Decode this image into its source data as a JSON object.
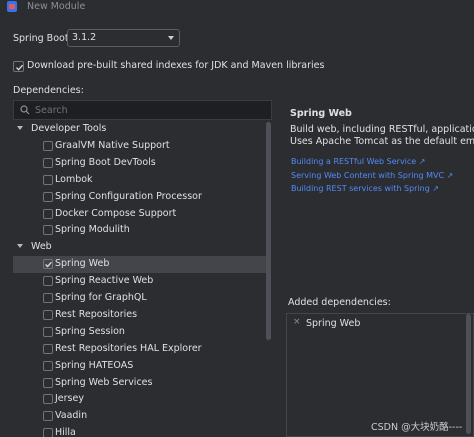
{
  "window": {
    "title": "New Module"
  },
  "spring_boot": {
    "label": "Spring Boot:",
    "value": "3.1.2"
  },
  "download_indexes": {
    "label": "Download pre-built shared indexes for JDK and Maven libraries",
    "checked": true
  },
  "dependencies": {
    "label": "Dependencies:",
    "search_placeholder": "Search",
    "tree": [
      {
        "type": "group",
        "label": "Developer Tools"
      },
      {
        "type": "item",
        "label": "GraalVM Native Support",
        "checked": false
      },
      {
        "type": "item",
        "label": "Spring Boot DevTools",
        "checked": false
      },
      {
        "type": "item",
        "label": "Lombok",
        "checked": false
      },
      {
        "type": "item",
        "label": "Spring Configuration Processor",
        "checked": false
      },
      {
        "type": "item",
        "label": "Docker Compose Support",
        "checked": false
      },
      {
        "type": "item",
        "label": "Spring Modulith",
        "checked": false
      },
      {
        "type": "group",
        "label": "Web"
      },
      {
        "type": "item",
        "label": "Spring Web",
        "checked": true,
        "selected": true
      },
      {
        "type": "item",
        "label": "Spring Reactive Web",
        "checked": false
      },
      {
        "type": "item",
        "label": "Spring for GraphQL",
        "checked": false
      },
      {
        "type": "item",
        "label": "Rest Repositories",
        "checked": false
      },
      {
        "type": "item",
        "label": "Spring Session",
        "checked": false
      },
      {
        "type": "item",
        "label": "Rest Repositories HAL Explorer",
        "checked": false
      },
      {
        "type": "item",
        "label": "Spring HATEOAS",
        "checked": false
      },
      {
        "type": "item",
        "label": "Spring Web Services",
        "checked": false
      },
      {
        "type": "item",
        "label": "Jersey",
        "checked": false
      },
      {
        "type": "item",
        "label": "Vaadin",
        "checked": false
      },
      {
        "type": "item",
        "label": "Hilla",
        "checked": false
      }
    ]
  },
  "detail": {
    "title": "Spring Web",
    "description_line1": "Build web, including RESTful, applications using",
    "description_line2": "Uses Apache Tomcat as the default embedded",
    "links": [
      "Building a RESTful Web Service ↗",
      "Serving Web Content with Spring MVC ↗",
      "Building REST services with Spring ↗"
    ]
  },
  "added": {
    "label": "Added dependencies:",
    "items": [
      {
        "label": "Spring Web",
        "remove_glyph": "×"
      }
    ]
  },
  "watermark": "CSDN @大块奶酪----",
  "colors": {
    "background": "#2b2d30",
    "text": "#dfe1e5",
    "link": "#548af7",
    "selection": "#43454a",
    "checkbox_accent": "#3574f0"
  }
}
